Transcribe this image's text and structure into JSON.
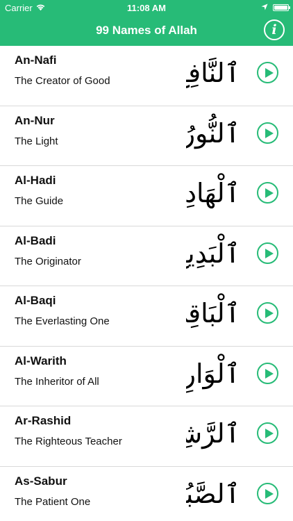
{
  "status_bar": {
    "carrier": "Carrier",
    "time": "11:08 AM"
  },
  "navbar": {
    "title": "99 Names of Allah",
    "info_icon": "i"
  },
  "names": [
    {
      "name": "An-Nafi",
      "meaning": "The Creator of Good",
      "arabic": "ٱلنَّافِعُ"
    },
    {
      "name": "An-Nur",
      "meaning": "The Light",
      "arabic": "ٱلنُّورُ"
    },
    {
      "name": "Al-Hadi",
      "meaning": "The Guide",
      "arabic": "ٱلْهَادِى"
    },
    {
      "name": "Al-Badi",
      "meaning": "The Originator",
      "arabic": "ٱلْبَدِيعُ"
    },
    {
      "name": "Al-Baqi",
      "meaning": "The Everlasting One",
      "arabic": "ٱلْبَاقِى"
    },
    {
      "name": "Al-Warith",
      "meaning": "The Inheritor of All",
      "arabic": "ٱلْوَارِثُ"
    },
    {
      "name": "Ar-Rashid",
      "meaning": "The Righteous Teacher",
      "arabic": "ٱلرَّشِيدُ"
    },
    {
      "name": "As-Sabur",
      "meaning": "The Patient One",
      "arabic": "ٱلصَّبُورُ"
    }
  ],
  "colors": {
    "accent": "#27bb77",
    "divider": "#d9d9d9"
  },
  "icons": {
    "wifi": "wifi-icon",
    "location": "location-arrow-icon",
    "battery": "battery-icon",
    "info": "info-icon",
    "play": "play-icon"
  }
}
